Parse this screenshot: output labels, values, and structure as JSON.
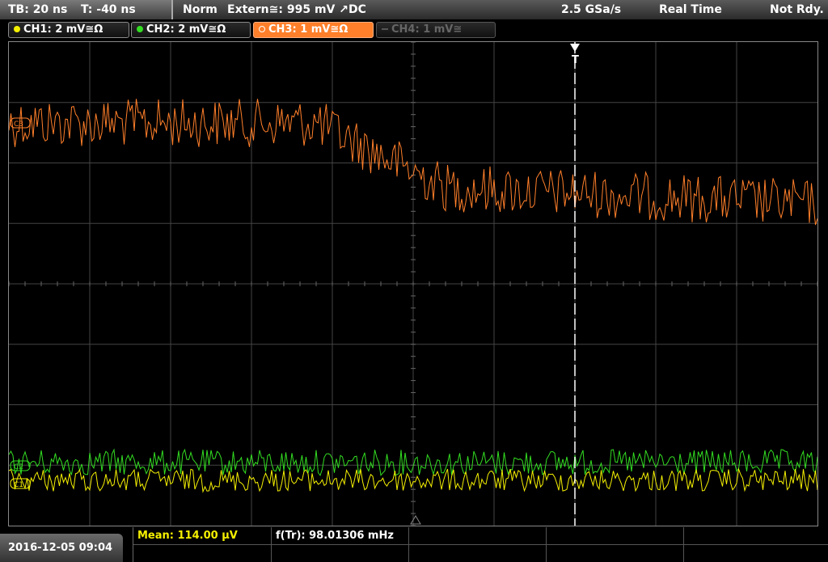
{
  "header": {
    "timebase": "TB: 20 ns",
    "trigger_time": "T: -40 ns",
    "trigger_mode": "Norm",
    "trigger_source": "Extern≅: 995 mV ↗DC",
    "sample_rate": "2.5 GSa/s",
    "acq_mode": "Real Time",
    "status": "Not Rdy."
  },
  "channels": [
    {
      "label": "CH1: 2 mV≅Ω",
      "color": "#f5f000",
      "active": true
    },
    {
      "label": "CH2: 2 mV≅Ω",
      "color": "#33dd22",
      "active": true
    },
    {
      "label": "CH3: 1 mV≅Ω",
      "color": "#ff7f2a",
      "active": true,
      "selected": true
    },
    {
      "label": "CH4: 1 mV≅",
      "color": "#666666",
      "active": false
    }
  ],
  "trigger_marker": "T",
  "channel_markers": [
    "C3",
    "C2",
    "C1"
  ],
  "footer": {
    "datetime": "2016-12-05 09:04",
    "meas1": "Mean: 114.00 µV",
    "meas2": "f(Tr): 98.01306 mHz"
  },
  "colors": {
    "ch1": "#f5f000",
    "ch2": "#33dd22",
    "ch3": "#ff7f2a",
    "grid": "#444444"
  }
}
